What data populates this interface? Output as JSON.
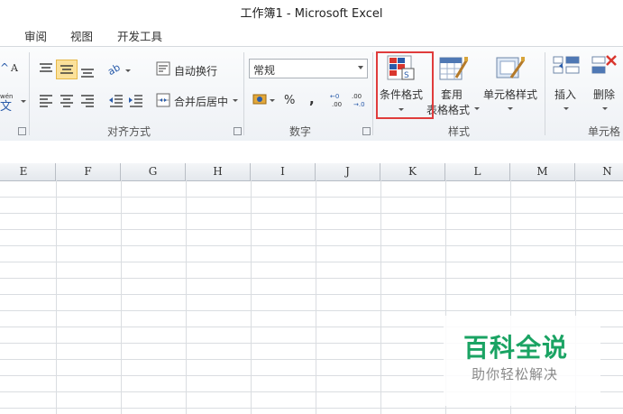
{
  "window": {
    "title": "工作簿1  -  Microsoft Excel"
  },
  "tabs": [
    {
      "label": "审阅"
    },
    {
      "label": "视图"
    },
    {
      "label": "开发工具"
    }
  ],
  "ribbon": {
    "font_partial": {
      "wen_label": "wén",
      "wen_glyph": "文"
    },
    "alignment": {
      "wrap_text": "自动换行",
      "merge_center": "合并后居中",
      "group_label": "对齐方式"
    },
    "number": {
      "format_value": "常规",
      "percent": "%",
      "comma": ",",
      "group_label": "数字"
    },
    "styles": {
      "conditional_formatting": "条件格式",
      "format_as_table_line1": "套用",
      "format_as_table_line2": "表格格式",
      "cell_styles": "单元格样式",
      "group_label": "样式"
    },
    "cells": {
      "insert": "插入",
      "delete": "删除",
      "group_label": "单元格"
    }
  },
  "columns": [
    "E",
    "F",
    "G",
    "H",
    "I",
    "J",
    "K",
    "L",
    "M",
    "N"
  ],
  "watermark": {
    "title": "百科全说",
    "subtitle": "助你轻松解决"
  },
  "colors": {
    "highlight": "#e03c3c",
    "watermark_green": "#1aa363"
  }
}
